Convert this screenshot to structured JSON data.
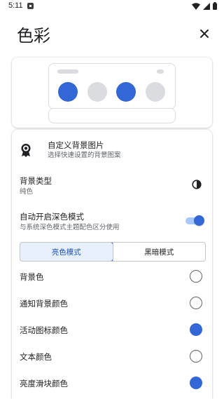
{
  "status": {
    "time": "5:11"
  },
  "header": {
    "title": "色彩"
  },
  "accent_color": "#3367d6",
  "preview": {
    "circles": [
      {
        "color": "#3367d6"
      },
      {
        "color": "#dadce0"
      },
      {
        "color": "#3367d6"
      },
      {
        "color": "#dadce0"
      }
    ]
  },
  "settings": {
    "custom_background": {
      "title": "自定义背景图片",
      "subtitle": "选择快速设置的背景图案"
    },
    "background_type": {
      "title": "背景类型",
      "value": "纯色"
    },
    "auto_dark": {
      "title": "自动开启深色模式",
      "subtitle": "与系统深色模式主题配色区分使用",
      "enabled": true
    },
    "mode_tabs": [
      {
        "label": "亮色模式",
        "selected": true
      },
      {
        "label": "黑暗模式",
        "selected": false
      }
    ],
    "color_rows": [
      {
        "label": "背景色",
        "filled": false
      },
      {
        "label": "通知背景颜色",
        "filled": false
      },
      {
        "label": "活动图标颜色",
        "filled": true
      },
      {
        "label": "文本颜色",
        "filled": false
      },
      {
        "label": "亮度滑块颜色",
        "filled": true
      }
    ]
  }
}
